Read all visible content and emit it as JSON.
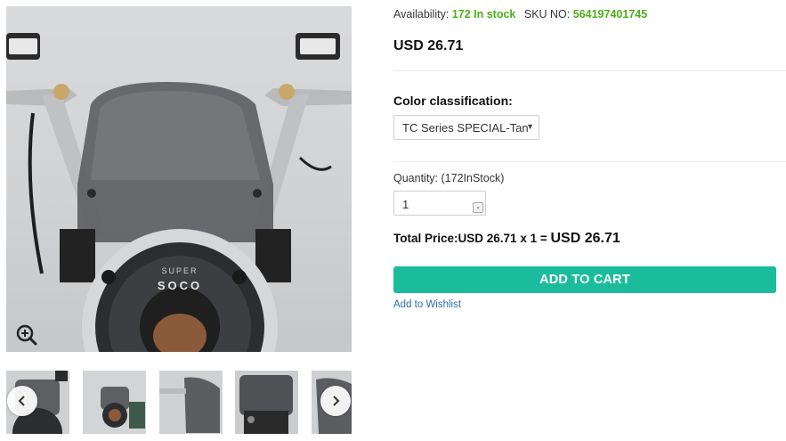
{
  "gallery": {
    "main_image": "motorcycle-windshield-photo",
    "zoom_icon": "zoom-in-icon",
    "thumbnails": [
      {
        "name": "thumbnail-1"
      },
      {
        "name": "thumbnail-2"
      },
      {
        "name": "thumbnail-3"
      },
      {
        "name": "thumbnail-4"
      },
      {
        "name": "thumbnail-5"
      }
    ],
    "prev_icon": "chevron-left-icon",
    "next_icon": "chevron-right-icon"
  },
  "product": {
    "availability_label": "Availability:",
    "stock_text": "172 In stock",
    "sku_label": "SKU NO:",
    "sku_value": "564197401745",
    "price": "USD 26.71",
    "color_label": "Color classification:",
    "color_selected": "TC Series SPECIAL-Tan",
    "quantity_label": "Quantity: (172InStock)",
    "quantity_value": "1",
    "total_label": "Total Price:",
    "total_calc": "USD 26.71 x 1 =",
    "total_value": "USD 26.71",
    "add_to_cart": "ADD TO CART",
    "wishlist": "Add to Wishlist"
  },
  "colors": {
    "accent": "#1bbc9b",
    "stock_green": "#4caf1a",
    "link": "#2a6fb0"
  }
}
